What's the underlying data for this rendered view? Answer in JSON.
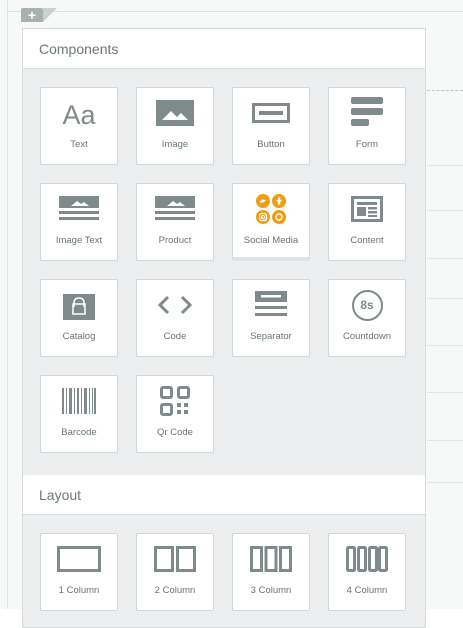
{
  "canvas": {
    "add_symbol": "+"
  },
  "components": {
    "title": "Components",
    "items": [
      {
        "label": "Text",
        "icon": "text-aa-icon"
      },
      {
        "label": "Image",
        "icon": "image-icon"
      },
      {
        "label": "Button",
        "icon": "button-icon"
      },
      {
        "label": "Form",
        "icon": "form-icon"
      },
      {
        "label": "Image Text",
        "icon": "image-text-icon"
      },
      {
        "label": "Product",
        "icon": "product-icon"
      },
      {
        "label": "Social Media",
        "icon": "social-media-icon"
      },
      {
        "label": "Content",
        "icon": "content-icon"
      },
      {
        "label": "Catalog",
        "icon": "catalog-bag-icon"
      },
      {
        "label": "Code",
        "icon": "code-brackets-icon"
      },
      {
        "label": "Separator",
        "icon": "separator-icon"
      },
      {
        "label": "Countdown",
        "icon": "countdown-icon"
      },
      {
        "label": "Barcode",
        "icon": "barcode-icon"
      },
      {
        "label": "Qr Code",
        "icon": "qr-code-icon"
      }
    ],
    "text_icon_glyph": "Aa",
    "countdown_glyph": "8s"
  },
  "layout": {
    "title": "Layout",
    "items": [
      {
        "label": "1 Column",
        "icon": "one-column-icon"
      },
      {
        "label": "2 Column",
        "icon": "two-column-icon"
      },
      {
        "label": "3 Column",
        "icon": "three-column-icon"
      },
      {
        "label": "4 Column",
        "icon": "four-column-icon"
      }
    ]
  },
  "colors": {
    "icon_gray": "#7f8a8a",
    "social_orange": "#f39c12",
    "panel_bg": "#eceeef"
  }
}
